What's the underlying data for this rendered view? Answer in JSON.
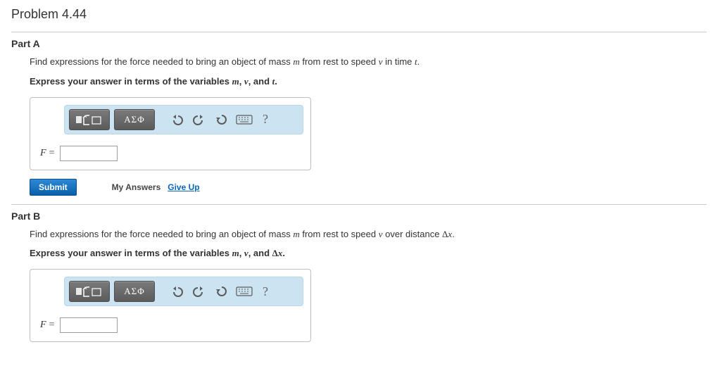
{
  "problem_title": "Problem 4.44",
  "parts": {
    "A": {
      "label": "Part A",
      "prompt_prefix": "Find expressions for the force needed to bring an object of mass ",
      "prompt_mid1": " from rest to speed ",
      "prompt_mid2": " in time ",
      "prompt_suffix": ".",
      "var1": "m",
      "var2": "v",
      "var3": "t",
      "hint_prefix": "Express your answer in terms of the variables ",
      "hint_and": ", and ",
      "hint_suffix": ".",
      "expr_label": "F",
      "answer_value": ""
    },
    "B": {
      "label": "Part B",
      "prompt_prefix": "Find expressions for the force needed to bring an object of mass ",
      "prompt_mid1": " from rest to speed ",
      "prompt_mid2": " over distance ",
      "prompt_suffix": ".",
      "var1": "m",
      "var2": "v",
      "var3_delta": "Δ",
      "var3_x": "x",
      "hint_prefix": "Express your answer in terms of the variables ",
      "hint_and": ", and ",
      "hint_suffix": ".",
      "expr_label": "F",
      "answer_value": ""
    }
  },
  "toolbar": {
    "templates_label": "▮√▢",
    "greek_label": "ΑΣΦ",
    "undo": "undo",
    "redo": "redo",
    "reset": "reset",
    "keyboard": "keyboard",
    "help": "?"
  },
  "actions": {
    "submit": "Submit",
    "my_answers": "My Answers",
    "give_up": "Give Up"
  }
}
